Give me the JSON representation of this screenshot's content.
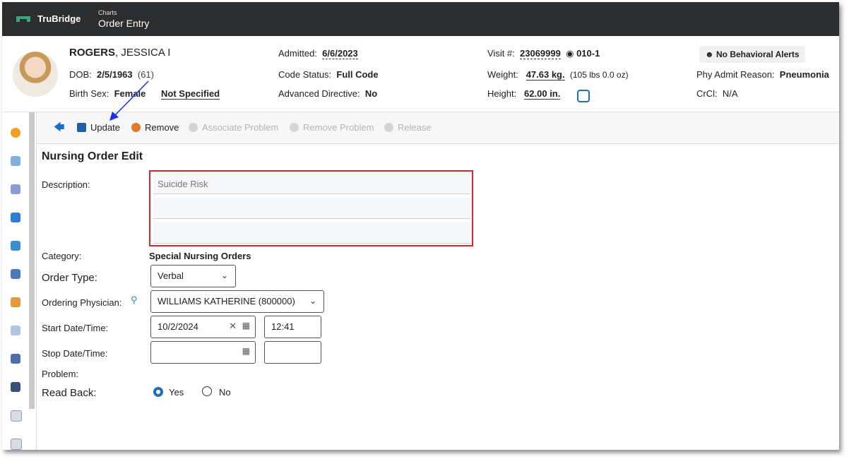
{
  "topbar": {
    "brand": "TruBridge",
    "section_small": "Charts",
    "section_main": "Order Entry"
  },
  "patient": {
    "last_name": "ROGERS",
    "first_name": ", JESSICA I",
    "dob_label": "DOB:",
    "dob": "2/5/1963",
    "age": "(61)",
    "sex_label": "Birth Sex:",
    "sex": "Female",
    "sex_extra": "Not Specified",
    "admitted_label": "Admitted:",
    "admitted": "6/6/2023",
    "code_status_label": "Code Status:",
    "code_status": "Full Code",
    "adv_dir_label": "Advanced Directive:",
    "adv_dir": "No",
    "visit_label": "Visit #:",
    "visit": "23069999",
    "room": "010-1",
    "weight_label": "Weight:",
    "weight": "47.63 kg.",
    "weight_lbs": "(105 lbs 0.0 oz)",
    "height_label": "Height:",
    "height": "62.00 in.",
    "alert_badge": "No Behavioral Alerts",
    "admit_reason_label": "Phy Admit Reason:",
    "admit_reason": "Pneumonia",
    "crcl_label": "CrCl:",
    "crcl": "N/A"
  },
  "toolbar": {
    "update": "Update",
    "remove": "Remove",
    "associate_problem": "Associate Problem",
    "remove_problem": "Remove Problem",
    "release": "Release"
  },
  "form": {
    "title": "Nursing Order Edit",
    "description_label": "Description:",
    "description_value": "Suicide Risk",
    "category_label": "Category:",
    "category_value": "Special Nursing Orders",
    "order_type_label": "Order Type:",
    "order_type_value": "Verbal",
    "physician_label": "Ordering Physician:",
    "physician_value": "WILLIAMS KATHERINE (800000)",
    "start_label": "Start Date/Time:",
    "start_date": "10/2/2024",
    "start_time": "12:41",
    "stop_label": "Stop Date/Time:",
    "stop_date": "",
    "stop_time": "",
    "problem_label": "Problem:",
    "read_back_label": "Read Back:",
    "read_back_yes": "Yes",
    "read_back_no": "No"
  },
  "colors": {
    "topbar": "#2b2d2f",
    "accent": "#1b6ec2",
    "highlight": "#d9262b",
    "annotation_arrow": "#1a2ee6"
  }
}
